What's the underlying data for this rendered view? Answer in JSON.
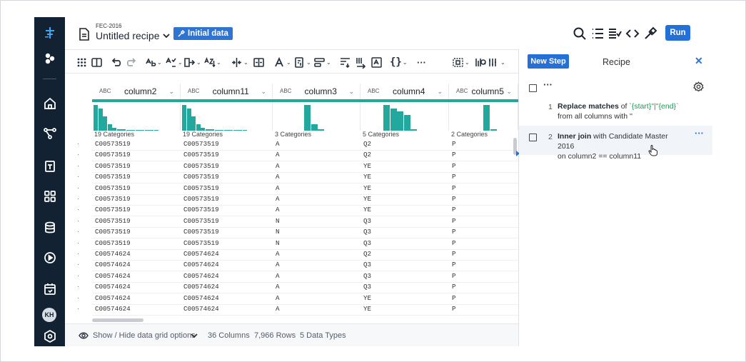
{
  "header": {
    "project": "FEC-2016",
    "recipe_title": "Untitled recipe",
    "initial_data_label": "Initial data",
    "run_label": "Run"
  },
  "grid": {
    "columns": [
      {
        "type": "ABC",
        "name": "column2",
        "categories": "19 Categories",
        "hist": [
          1.0,
          0.85,
          0.55,
          0.25,
          0.12,
          0.06,
          0.05,
          0.04,
          0.04,
          0.03,
          0.03,
          0.02,
          0.02,
          0.02
        ]
      },
      {
        "type": "ABC",
        "name": "column11",
        "categories": "19 Categories",
        "hist": [
          1.0,
          0.85,
          0.55,
          0.25,
          0.12,
          0.06,
          0.05,
          0.04,
          0.04,
          0.03,
          0.03,
          0.02,
          0.02,
          0.02
        ]
      },
      {
        "type": "ABC",
        "name": "column3",
        "categories": "3 Categories",
        "hist": [
          1.0,
          0.25,
          0.05
        ]
      },
      {
        "type": "ABC",
        "name": "column4",
        "categories": "5 Categories",
        "hist": [
          1.0,
          0.85,
          0.75,
          0.6,
          0.05
        ]
      },
      {
        "type": "ABC",
        "name": "column5",
        "categories": "2 Categories",
        "hist": [
          1.0,
          0.05
        ]
      }
    ],
    "rows": [
      [
        "C00573519",
        "C00573519",
        "A",
        "Q2",
        "P"
      ],
      [
        "C00573519",
        "C00573519",
        "A",
        "Q2",
        "P"
      ],
      [
        "C00573519",
        "C00573519",
        "A",
        "YE",
        "P"
      ],
      [
        "C00573519",
        "C00573519",
        "A",
        "YE",
        "P"
      ],
      [
        "C00573519",
        "C00573519",
        "A",
        "YE",
        "P"
      ],
      [
        "C00573519",
        "C00573519",
        "A",
        "YE",
        "P"
      ],
      [
        "C00573519",
        "C00573519",
        "A",
        "YE",
        "P"
      ],
      [
        "C00573519",
        "C00573519",
        "N",
        "Q3",
        "P"
      ],
      [
        "C00573519",
        "C00573519",
        "N",
        "Q3",
        "P"
      ],
      [
        "C00573519",
        "C00573519",
        "N",
        "Q3",
        "P"
      ],
      [
        "C00574624",
        "C00574624",
        "A",
        "Q2",
        "P"
      ],
      [
        "C00574624",
        "C00574624",
        "A",
        "Q3",
        "P"
      ],
      [
        "C00574624",
        "C00574624",
        "A",
        "Q3",
        "P"
      ],
      [
        "C00574624",
        "C00574624",
        "A",
        "Q3",
        "P"
      ],
      [
        "C00574624",
        "C00574624",
        "A",
        "YE",
        "P"
      ],
      [
        "C00574624",
        "C00574624",
        "A",
        "YE",
        "P"
      ]
    ]
  },
  "status": {
    "toggle_label": "Show / Hide data grid options",
    "columns": "36 Columns",
    "rows": "7,966 Rows",
    "types": "5 Data Types"
  },
  "recipe": {
    "new_step_label": "New Step",
    "title": "Recipe",
    "steps": [
      {
        "num": "1",
        "action": "Replace matches",
        "t1": " of ",
        "pattern": "`{start}\"|\"{end}`",
        "line2": "from all columns with ''"
      },
      {
        "num": "2",
        "action": "Inner join",
        "t1": " with Candidate Master 2016",
        "line2": "on column2 == column11"
      }
    ]
  },
  "colors": {
    "rail": "#132232",
    "accent": "#2470d6",
    "histogram": "#23a89d"
  }
}
